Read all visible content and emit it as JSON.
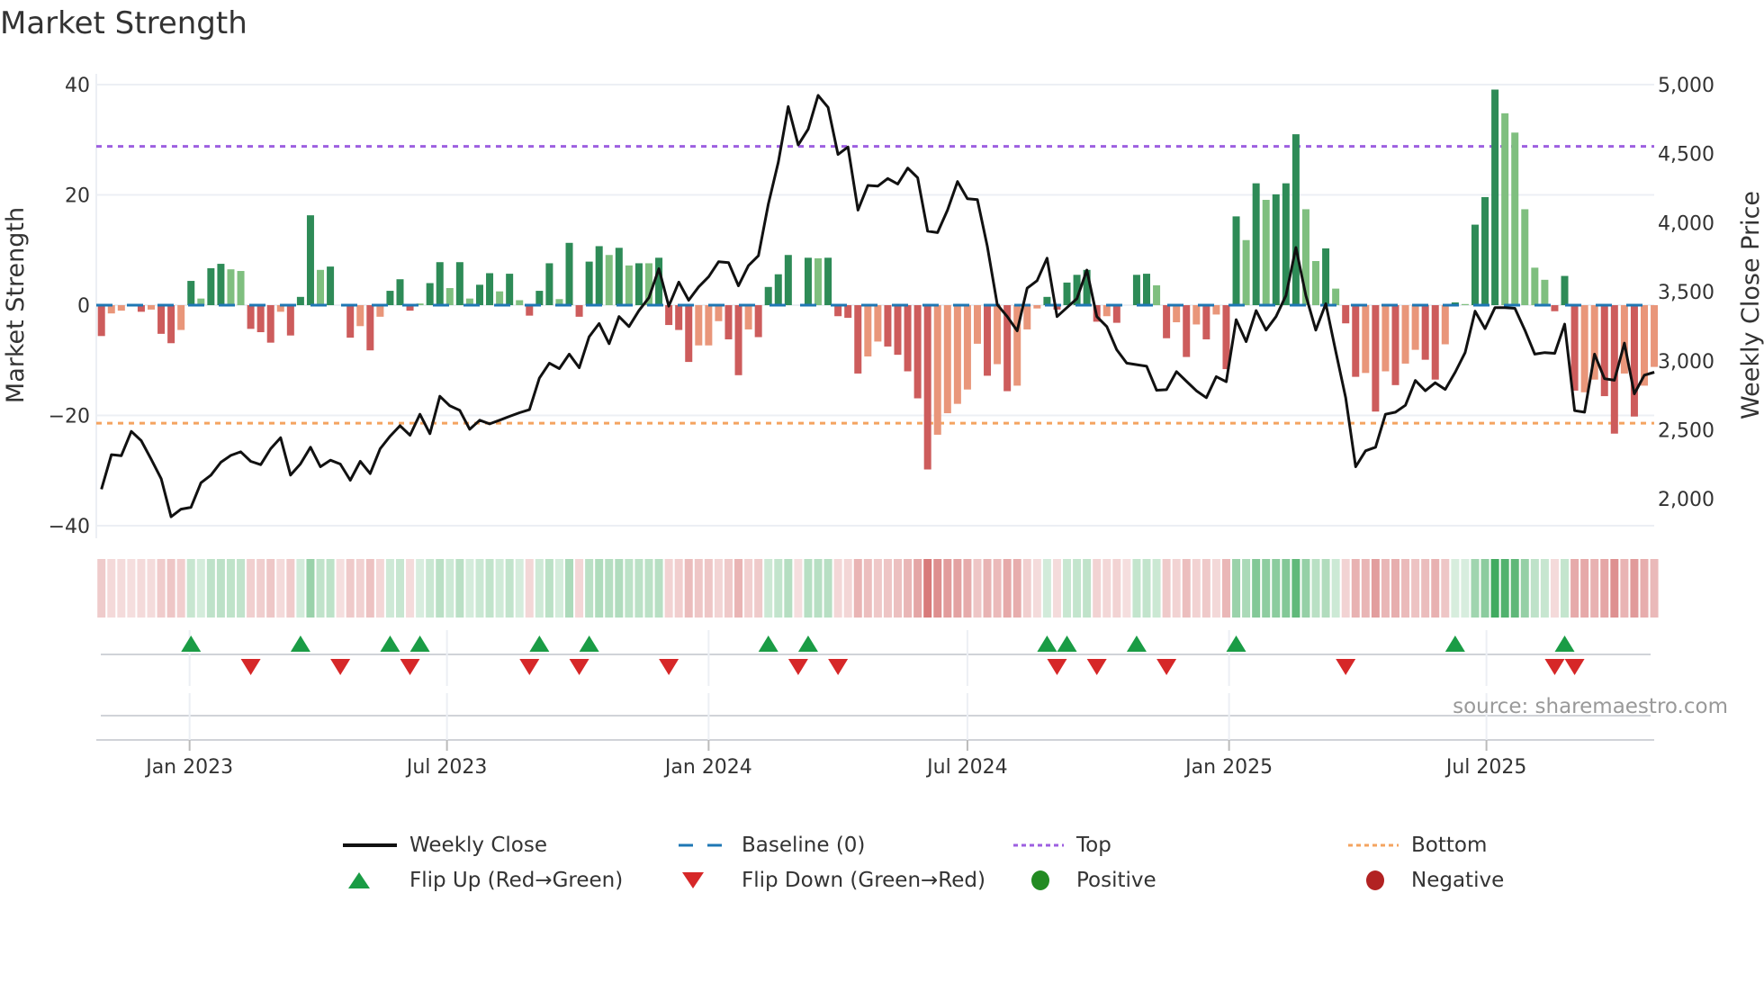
{
  "title": "Market Strength",
  "source": "source: sharemaestro.com",
  "legend": {
    "weekly_close": "Weekly Close",
    "baseline": "Baseline (0)",
    "top": "Top",
    "bottom": "Bottom",
    "flip_up": "Flip Up (Red→Green)",
    "flip_down": "Flip Down (Green→Red)",
    "positive": "Positive",
    "negative": "Negative"
  },
  "colors": {
    "pos_strong": "#2e8b57",
    "pos_weak": "#7fbf7f",
    "neg_strong": "#cd5c5c",
    "neg_weak": "#e9967a",
    "baseline": "#1f77b4",
    "top": "#9d5fe0",
    "bottom": "#f4a460",
    "flip_up": "#1a9c45",
    "flip_down": "#d62728",
    "positive": "#228b22",
    "negative": "#b22222",
    "price": "#111111"
  },
  "chart_data": {
    "type": "bar+line",
    "title": "Market Strength",
    "ylabel": "Market Strength",
    "y2label": "Weekly Close Price",
    "ylim": [
      -42,
      42
    ],
    "y2lim": [
      1800,
      5100
    ],
    "yticks": [
      {
        "v": 40,
        "label": "40"
      },
      {
        "v": 20,
        "label": "20"
      },
      {
        "v": 0,
        "label": "0"
      },
      {
        "v": -20,
        "label": "−20"
      },
      {
        "v": -40,
        "label": "−40"
      }
    ],
    "y2ticks": [
      {
        "v": 5000,
        "label": "5,000"
      },
      {
        "v": 4500,
        "label": "4,500"
      },
      {
        "v": 4000,
        "label": "4,000"
      },
      {
        "v": 3500,
        "label": "3,500"
      },
      {
        "v": 3000,
        "label": "3,000"
      },
      {
        "v": 2500,
        "label": "2,500"
      },
      {
        "v": 2000,
        "label": "2,000"
      }
    ],
    "xticks": [
      {
        "date": "2023-01-01",
        "label": "Jan 2023"
      },
      {
        "date": "2023-07-01",
        "label": "Jul 2023"
      },
      {
        "date": "2024-01-01",
        "label": "Jan 2024"
      },
      {
        "date": "2024-07-01",
        "label": "Jul 2024"
      },
      {
        "date": "2025-01-01",
        "label": "Jan 2025"
      },
      {
        "date": "2025-07-01",
        "label": "Jul 2025"
      }
    ],
    "start_date": "2022-10-31",
    "frequency": "weekly",
    "top_level": 28.8,
    "bottom_level": -21.4,
    "strength": [
      -5.6,
      -1.5,
      -1.0,
      0,
      -1.2,
      -0.8,
      -5.2,
      -6.9,
      -4.5,
      4.4,
      1.2,
      6.7,
      7.5,
      6.5,
      6.2,
      -4.3,
      -4.9,
      -6.8,
      -1.2,
      -5.5,
      1.5,
      16.3,
      6.4,
      7.0,
      0,
      -5.9,
      -3.8,
      -8.2,
      -2.1,
      2.6,
      4.7,
      -1.0,
      0.3,
      4.0,
      7.8,
      3.1,
      7.8,
      1.2,
      3.7,
      5.8,
      2.5,
      5.7,
      0.9,
      -1.9,
      2.6,
      7.6,
      1.1,
      11.3,
      -2.1,
      7.9,
      10.7,
      9.1,
      10.4,
      7.2,
      7.6,
      7.6,
      8.6,
      -3.6,
      -4.5,
      -10.3,
      -7.3,
      -7.3,
      -2.9,
      -6.2,
      -12.7,
      -4.4,
      -5.8,
      3.3,
      5.6,
      9.1,
      0,
      8.6,
      8.5,
      8.6,
      -2.0,
      -2.3,
      -12.4,
      -9.3,
      -6.6,
      -7.5,
      -9.0,
      -12.0,
      -16.9,
      -29.8,
      -23.5,
      -19.6,
      -17.9,
      -15.3,
      -7.0,
      -12.8,
      -10.7,
      -15.6,
      -14.6,
      -4.4,
      -0.6,
      1.5,
      -0.8,
      4.1,
      5.5,
      6.4,
      -3.0,
      -2.0,
      -3.2,
      0,
      5.5,
      5.7,
      3.6,
      -6.0,
      -3.1,
      -9.4,
      -3.5,
      -6.2,
      -1.7,
      -11.6,
      16.1,
      11.8,
      22.1,
      19.1,
      20.1,
      22.1,
      31.0,
      17.4,
      8.0,
      10.3,
      3.0,
      -3.3,
      -13.0,
      -12.3,
      -19.3,
      -12.0,
      -14.5,
      -10.6,
      -8.1,
      -9.9,
      -13.5,
      -7.1,
      0.5,
      0.2,
      14.6,
      19.6,
      39.1,
      34.8,
      31.3,
      17.4,
      6.8,
      4.6,
      -1.1,
      5.3,
      -15.5,
      -15.8,
      -13.5,
      -16.5,
      -23.3,
      -12.4,
      -20.2,
      -14.6,
      -11.2
    ],
    "strength_class": "Rrr0RrRRrGgGGggRRRrRGGgG0RrRrGGRgGGgGgGGgGgRGGgGRGGgGgGgGRRRrrrRRrRGGG0GgGRRRrrRRRRRrrrrrRrRrrrGRGGGRrR0GGgRrRrRrRGgGgGGGggGgRRrRrRrrRRrGgGGGgggggRGRrrRRrRrr",
    "weekly_close": [
      2070,
      2320,
      2313,
      2489,
      2422,
      2287,
      2146,
      1870,
      1926,
      1939,
      2117,
      2172,
      2265,
      2315,
      2341,
      2272,
      2248,
      2363,
      2443,
      2172,
      2254,
      2374,
      2233,
      2280,
      2252,
      2135,
      2272,
      2183,
      2363,
      2454,
      2530,
      2461,
      2613,
      2472,
      2743,
      2674,
      2641,
      2504,
      2570,
      2543,
      2570,
      2598,
      2624,
      2646,
      2874,
      2983,
      2943,
      3048,
      2950,
      3174,
      3270,
      3124,
      3320,
      3248,
      3363,
      3457,
      3667,
      3396,
      3570,
      3439,
      3535,
      3609,
      3717,
      3711,
      3543,
      3689,
      3761,
      4135,
      4439,
      4841,
      4563,
      4678,
      4922,
      4835,
      4494,
      4548,
      4091,
      4270,
      4265,
      4320,
      4280,
      4396,
      4326,
      3939,
      3928,
      4091,
      4298,
      4174,
      4167,
      3830,
      3407,
      3320,
      3217,
      3526,
      3580,
      3743,
      3320,
      3385,
      3450,
      3657,
      3320,
      3248,
      3080,
      2983,
      2972,
      2961,
      2787,
      2791,
      2922,
      2852,
      2783,
      2733,
      2885,
      2848,
      3298,
      3139,
      3363,
      3222,
      3320,
      3472,
      3820,
      3472,
      3222,
      3413,
      3070,
      2733,
      2233,
      2348,
      2374,
      2613,
      2628,
      2678,
      2857,
      2783,
      2841,
      2793,
      2917,
      3059,
      3359,
      3233,
      3385,
      3385,
      3380,
      3222,
      3048,
      3059,
      3054,
      3265,
      2639,
      2628,
      3048,
      2870,
      2859,
      3128,
      2761,
      2896,
      2917
    ],
    "flip_up_weeks": [
      9,
      20,
      29,
      32,
      44,
      49,
      67,
      71,
      95,
      97,
      104,
      114,
      136,
      147
    ],
    "flip_down_weeks": [
      15,
      24,
      31,
      43,
      48,
      57,
      70,
      74,
      96,
      100,
      107,
      125,
      146,
      148
    ],
    "legend_position": "bottom"
  }
}
